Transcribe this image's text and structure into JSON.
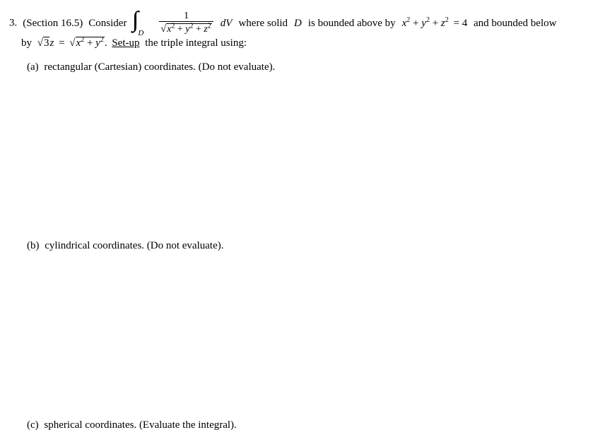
{
  "problem": {
    "number_label": "3.",
    "section_label": "(Section 16.5)",
    "lead": "Consider",
    "integral": {
      "region_sub": "D",
      "numerator": "1",
      "denom_radicand_x2": "x² + y² + z²"
    },
    "dV": "dV",
    "where": "where solid",
    "Dname": "D",
    "bounded_above": "is bounded above by",
    "sphere_lhs": "x² + y² + z²",
    "eq4": "= 4",
    "and_below": "and bounded below",
    "line2_by": "by",
    "sqrt3": "3",
    "z_eq": "z =",
    "cone_rhs": "x² + y²",
    "setup": "Set-up",
    "setup_tail": "the triple integral using:",
    "parts": {
      "a": {
        "label": "(a)",
        "text": "rectangular (Cartesian) coordinates. (Do not evaluate)."
      },
      "b": {
        "label": "(b)",
        "text": "cylindrical coordinates. (Do not evaluate)."
      },
      "c": {
        "label": "(c)",
        "text": "spherical coordinates. (Evaluate the integral)."
      }
    }
  }
}
